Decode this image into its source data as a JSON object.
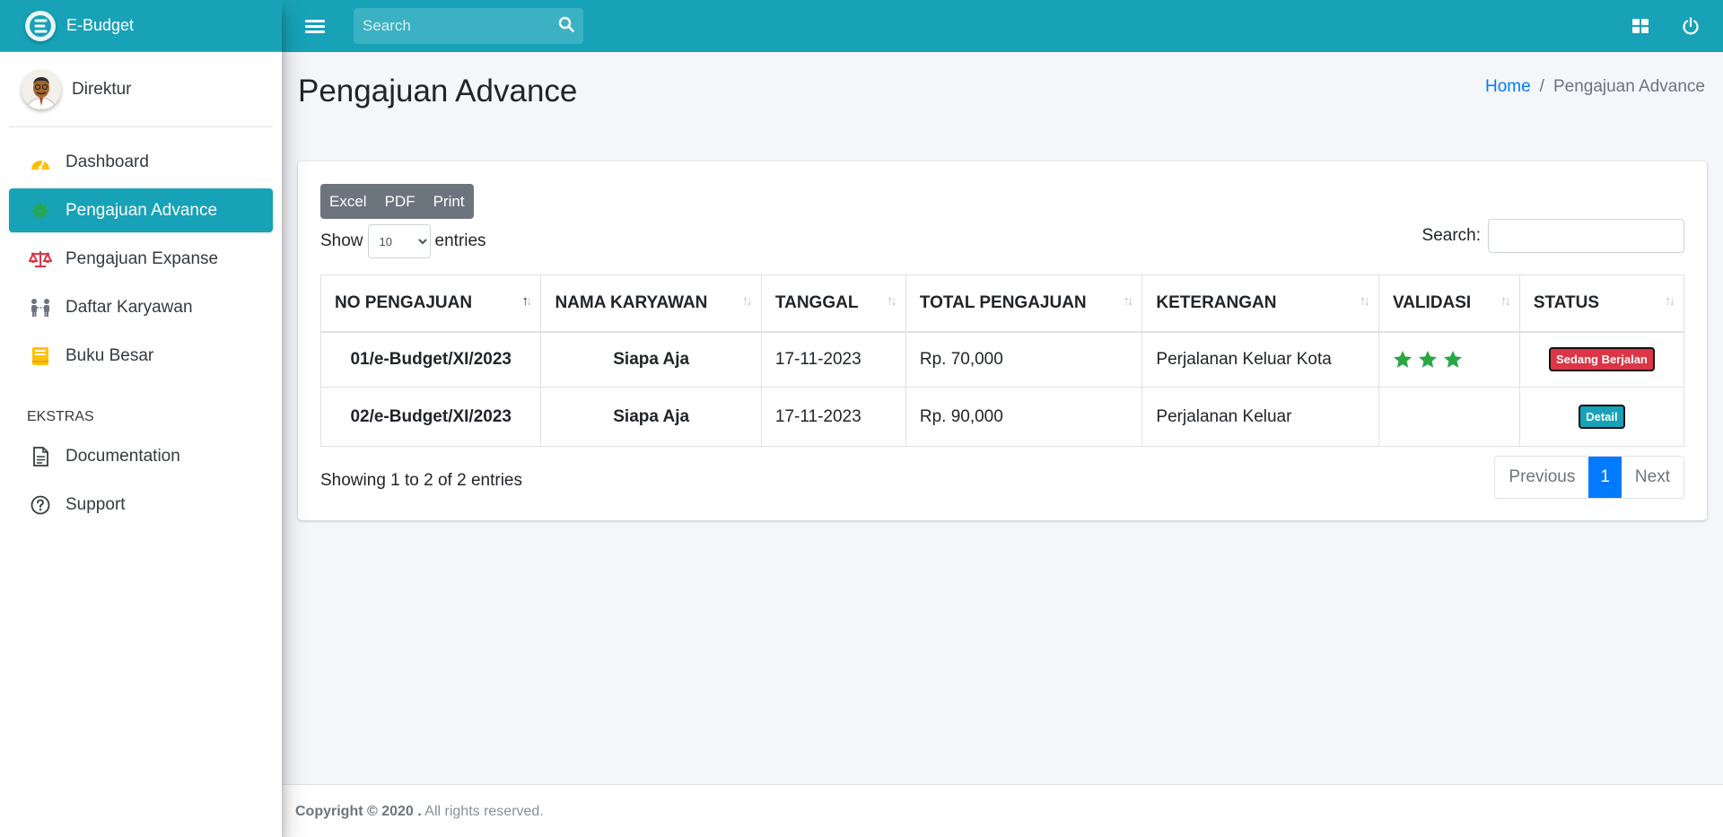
{
  "brand": {
    "name": "E-Budget"
  },
  "user": {
    "name": "Direktur"
  },
  "sidebar": {
    "items": [
      {
        "label": "Dashboard",
        "icon": "tachometer-icon",
        "color": "#ffc107"
      },
      {
        "label": "Pengajuan Advance",
        "icon": "gear-icon",
        "color": "#28a745",
        "active": true
      },
      {
        "label": "Pengajuan Expanse",
        "icon": "balance-scale-icon",
        "color": "#dc3545"
      },
      {
        "label": "Daftar Karyawan",
        "icon": "people-icon",
        "color": "#6c757d"
      },
      {
        "label": "Buku Besar",
        "icon": "book-icon",
        "color": "#ffc107"
      }
    ],
    "header": "EKSTRAS",
    "extras": [
      {
        "label": "Documentation",
        "icon": "file-icon"
      },
      {
        "label": "Support",
        "icon": "question-circle-icon"
      }
    ]
  },
  "topbar": {
    "search_placeholder": "Search"
  },
  "page": {
    "title": "Pengajuan Advance",
    "breadcrumb": {
      "home": "Home",
      "separator": "/",
      "current": "Pengajuan Advance"
    }
  },
  "toolbar": {
    "excel": "Excel",
    "pdf": "PDF",
    "print": "Print"
  },
  "length": {
    "show": "Show",
    "value": "10",
    "entries": "entries"
  },
  "filter": {
    "label": "Search:"
  },
  "table": {
    "headers": [
      "NO PENGAJUAN",
      "NAMA KARYAWAN",
      "TANGGAL",
      "TOTAL PENGAJUAN",
      "KETERANGAN",
      "VALIDASI",
      "STATUS"
    ],
    "rows": [
      {
        "no": "01/e-Budget/XI/2023",
        "nama": "Siapa Aja",
        "tanggal": "17-11-2023",
        "total": "Rp. 70,000",
        "keterangan": "Perjalanan Keluar Kota",
        "validasi_stars": 3,
        "status": "Sedang Berjalan"
      },
      {
        "no": "02/e-Budget/XI/2023",
        "nama": "Siapa Aja",
        "tanggal": "17-11-2023",
        "total": "Rp. 90,000",
        "keterangan": "Perjalanan Keluar",
        "validasi_stars": 0,
        "status": "Detail"
      }
    ]
  },
  "info": "Showing 1 to 2 of 2 entries",
  "pagination": {
    "previous": "Previous",
    "current": "1",
    "next": "Next"
  },
  "footer": {
    "copyright": "Copyright © 2020 .",
    "rights": " All rights reserved."
  },
  "colors": {
    "primary": "#17a2b8",
    "link": "#007bff",
    "danger": "#dc3545",
    "success": "#28a745"
  }
}
